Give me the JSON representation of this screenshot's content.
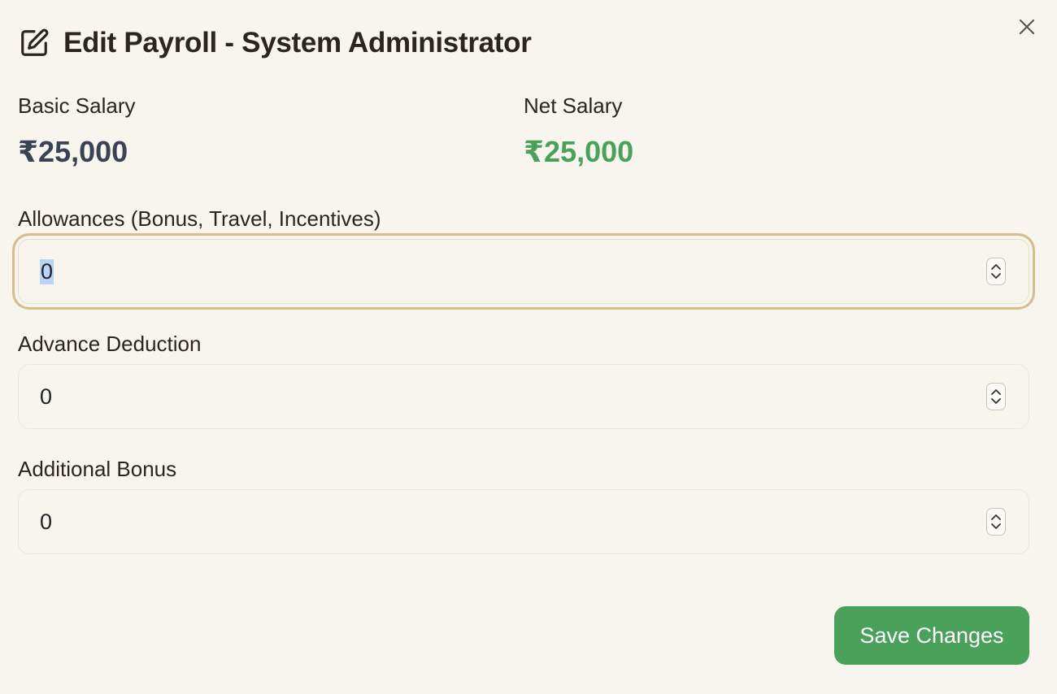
{
  "dialog": {
    "title": "Edit Payroll - System Administrator",
    "title_icon": "edit-icon",
    "close_icon": "close-icon"
  },
  "summary": {
    "basic_label": "Basic Salary",
    "basic_value": "₹25,000",
    "net_label": "Net Salary",
    "net_value": "₹25,000"
  },
  "fields": {
    "allowances": {
      "label": "Allowances (Bonus, Travel, Incentives)",
      "value": "0"
    },
    "advance_deduction": {
      "label": "Advance Deduction",
      "value": "0"
    },
    "additional_bonus": {
      "label": "Additional Bonus",
      "value": "0"
    }
  },
  "actions": {
    "save_label": "Save Changes"
  },
  "colors": {
    "accent_green": "#4aa15a",
    "background": "#f8f5ee",
    "focus_ring": "#d4bd8e"
  }
}
